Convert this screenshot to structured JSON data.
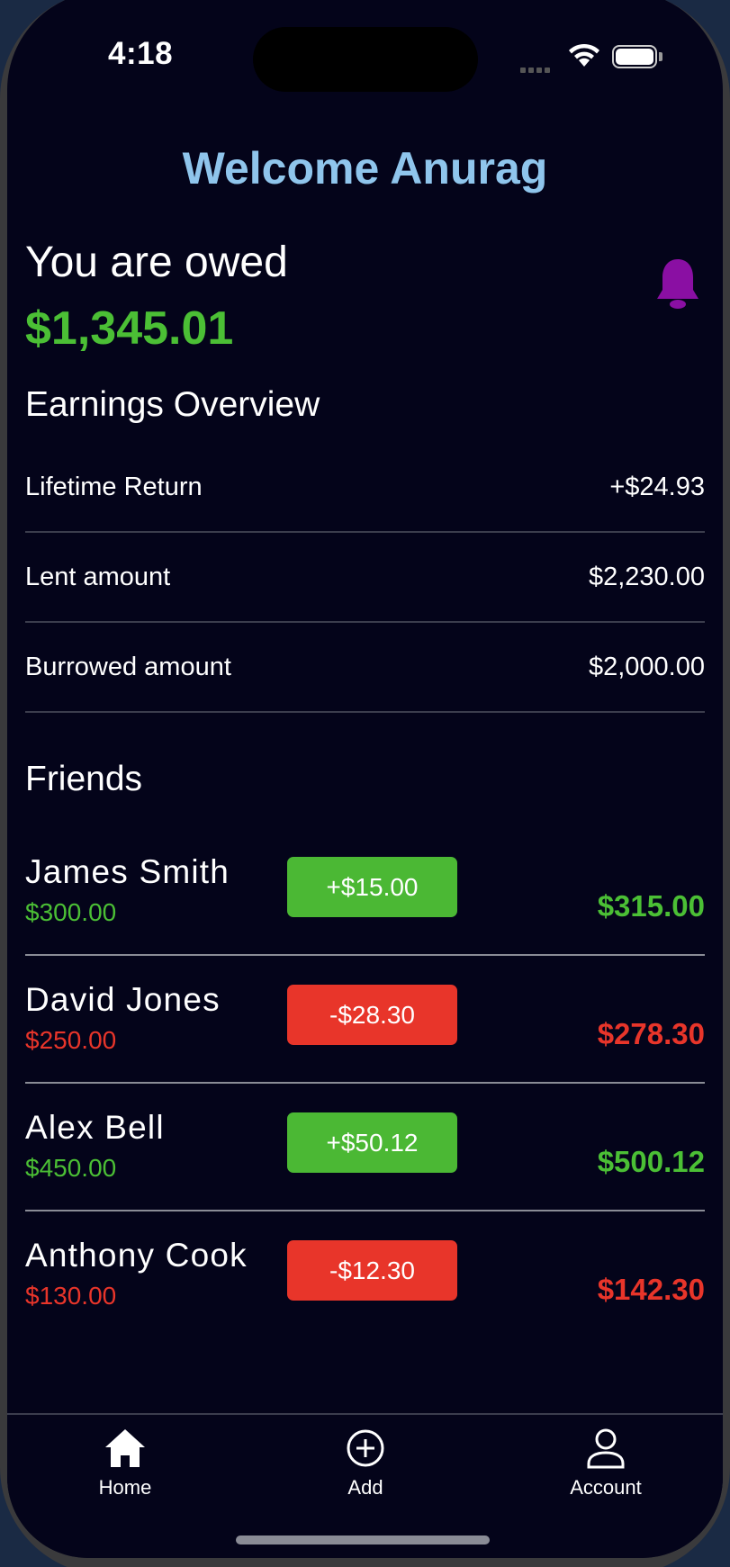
{
  "status_bar": {
    "time": "4:18"
  },
  "header": {
    "title": "Welcome Anurag"
  },
  "owed": {
    "label": "You are owed",
    "amount": "$1,345.01"
  },
  "earnings": {
    "title": "Earnings Overview",
    "rows": [
      {
        "label": "Lifetime Return",
        "value": "+$24.93"
      },
      {
        "label": "Lent amount",
        "value": "$2,230.00"
      },
      {
        "label": "Burrowed amount",
        "value": "$2,000.00"
      }
    ]
  },
  "friends": {
    "title": "Friends",
    "items": [
      {
        "name": "James Smith",
        "base": "$300.00",
        "change": "+$15.00",
        "total": "$315.00",
        "status": "positive"
      },
      {
        "name": "David Jones",
        "base": "$250.00",
        "change": "-$28.30",
        "total": "$278.30",
        "status": "negative"
      },
      {
        "name": "Alex Bell",
        "base": "$450.00",
        "change": "+$50.12",
        "total": "$500.12",
        "status": "positive"
      },
      {
        "name": "Anthony Cook",
        "base": "$130.00",
        "change": "-$12.30",
        "total": "$142.30",
        "status": "negative"
      }
    ]
  },
  "tabbar": {
    "items": [
      {
        "label": "Home",
        "icon": "home-icon"
      },
      {
        "label": "Add",
        "icon": "add-circle-icon"
      },
      {
        "label": "Account",
        "icon": "person-icon"
      }
    ]
  },
  "colors": {
    "background": "#04041a",
    "accent_title": "#8fc5ec",
    "positive": "#4bbf35",
    "negative": "#e8352a",
    "bell": "#8a0fa3"
  }
}
